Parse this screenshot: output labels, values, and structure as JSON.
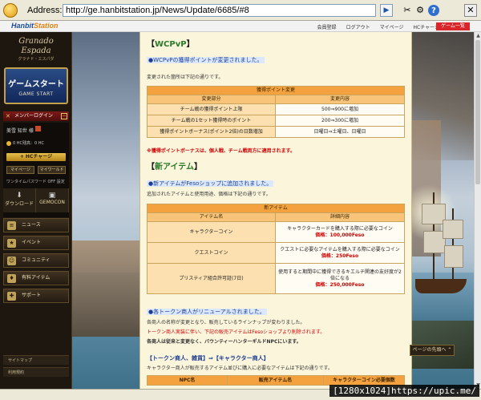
{
  "browser": {
    "address_label": "Address:",
    "url": "http://ge.hanbitstation.jp/News/Update/6685/#8",
    "icons": [
      "go-icon",
      "tools-icon",
      "settings-icon",
      "help-icon",
      "close-icon"
    ]
  },
  "site_header": {
    "brand_a": "Hanbit",
    "brand_b": "Station",
    "links": [
      "会員登録",
      "ログアウト",
      "マイページ",
      "HCチャージ"
    ],
    "signup": "ゲーム一覧"
  },
  "sidebar": {
    "logo_title": "Granado Espada",
    "logo_sub": "グラナド・エスパダ",
    "start_jp": "ゲームスタート",
    "start_en": "GAME START",
    "login_header": "メンバーログイン",
    "user_name": "美雪 知世 様",
    "hc_balance": "0 HC残高：0 HC",
    "hc_charge": "+ HCチャージ",
    "btn_mypage": "マイページ",
    "btn_myworld": "マイワールド",
    "otp": "ワンタイムパスワード OFF  設定",
    "quick": [
      {
        "label": "ダウンロード",
        "icon": "download-icon"
      },
      {
        "label": "GEMOCON",
        "icon": "gemocon-icon"
      }
    ],
    "menu": [
      {
        "label": "ニュース",
        "icon": "news-icon"
      },
      {
        "label": "イベント",
        "icon": "event-icon"
      },
      {
        "label": "コミュニティ",
        "icon": "community-icon"
      },
      {
        "label": "有料アイテム",
        "icon": "item-icon"
      },
      {
        "label": "サポート",
        "icon": "support-icon"
      }
    ],
    "footer": [
      "サイトマップ",
      "利用規約"
    ]
  },
  "content": {
    "wcpvp_heading": "WCPvP",
    "wcpvp_bullet": "●WCPvPの獲得ポイントが変更されました。",
    "wcpvp_note": "変更された箇所は下記の通りです。",
    "table1": {
      "caption": "獲得ポイント変更",
      "headers": [
        "変更部分",
        "変更内容"
      ],
      "rows": [
        [
          "チーム戦の獲得ポイント上限",
          "500⇒900に増加"
        ],
        [
          "チーム戦の1セット獲得時のポイント",
          "200⇒300に増加"
        ],
        [
          "獲得ポイントボーナス(ポイント2倍)の日数増加",
          "日曜日⇒土曜日、日曜日"
        ]
      ]
    },
    "wcpvp_warning": "※獲得ポイントボーナスは、個人戦、チーム戦両方に適用されます。",
    "item_heading": "新アイテム",
    "item_bullet": "●新アイテムがFesoショップに追加されました。",
    "item_note": "追加されたアイテムと使用用途、価格は下記の通りです。",
    "table2": {
      "caption": "新アイテム",
      "headers": [
        "アイテム名",
        "詳細内容"
      ],
      "rows": [
        {
          "name": "キャラクターコイン",
          "desc": "キャラクターカードを購入する際に必要なコイン",
          "price": "価格：100,000Feso"
        },
        {
          "name": "クエストコイン",
          "desc": "クエストに必要なアイテムを購入する際に必要なコイン",
          "price": "価格：250Feso"
        },
        {
          "name": "プリスティア組合許可証(7日)",
          "desc": "使用すると期間中に獲得できるキエルチ関連の友好度が2倍になる",
          "price": "価格：250,000Feso"
        }
      ]
    },
    "token_bullet": "●各トークン商人がリニューアルされました。",
    "token_note1": "各商人の名称が変更となり、販売しているラインナップが変わりました。",
    "token_note2": "トークン商人実装に伴い、下記の販売アイテムはFesoショップより削除されます。",
    "token_note3": "各商人は従来と変更なく、バウンティーハンターギルドNPCにいます。",
    "token_link": "【トークン商人、雑貨】⇒【キャラクター商人】",
    "token_note4": "キャラクター商人が販売するアイテム並びに購入に必要なアイテムは下記の通りです。",
    "table3_headers": [
      "NPC名",
      "販売アイテム名",
      "キャラクターコイン必要個数"
    ],
    "to_top": "ページの先頭へ"
  },
  "overlay": {
    "watermark": "[1280x1024]https://upic.me/"
  }
}
